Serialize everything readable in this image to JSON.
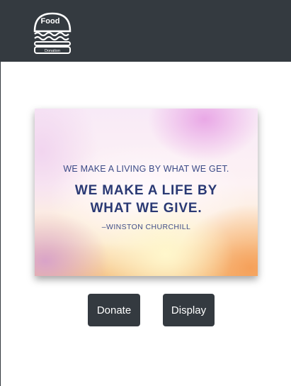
{
  "navbar": {
    "logo": {
      "icon": "burger-logo-icon",
      "top_text": "Food",
      "bottom_text": "Donation"
    }
  },
  "quote": {
    "line1": "WE MAKE A LIVING BY WHAT WE GET.",
    "line2": "WE MAKE A LIFE BY",
    "line3": "WHAT WE GIVE.",
    "author": "–WINSTON CHURCHILL"
  },
  "buttons": {
    "donate_label": "Donate",
    "display_label": "Display"
  },
  "colors": {
    "navbar": "#343a40",
    "button": "#343a40",
    "quote_text": "#2a3974"
  }
}
